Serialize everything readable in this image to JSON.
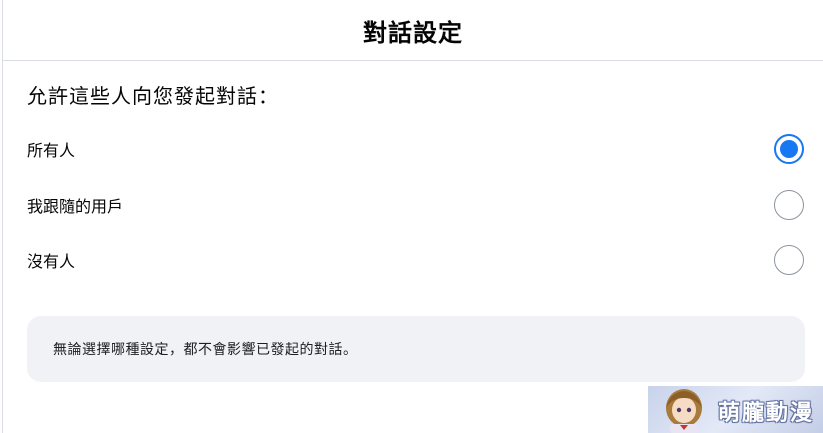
{
  "header": {
    "title": "對話設定"
  },
  "question": "允許這些人向您發起對話：",
  "options": [
    {
      "label": "所有人",
      "selected": true
    },
    {
      "label": "我跟隨的用戶",
      "selected": false
    },
    {
      "label": "沒有人",
      "selected": false
    }
  ],
  "note": "無論選擇哪種設定，都不會影響已發起的對話。",
  "watermark": {
    "text": "萌朧動漫"
  },
  "colors": {
    "accent": "#1877f2",
    "note_bg": "#f0f2f5",
    "divider": "#dadde1"
  }
}
